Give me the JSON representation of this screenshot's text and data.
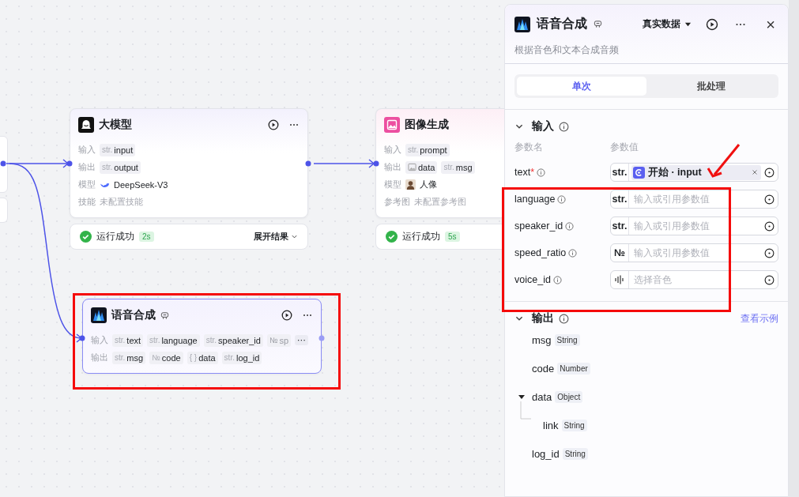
{
  "canvas": {
    "nodes": [
      {
        "title": "大模型",
        "kind": "llm",
        "selected": false,
        "rows": [
          {
            "label": "输入",
            "kind": "params",
            "params": [
              {
                "type": "str.",
                "name": "input"
              }
            ]
          },
          {
            "label": "输出",
            "kind": "params",
            "params": [
              {
                "type": "str.",
                "name": "output"
              }
            ]
          },
          {
            "label": "模型",
            "kind": "model",
            "value": "DeepSeek-V3"
          },
          {
            "label": "技能",
            "kind": "empty",
            "value": "未配置技能"
          }
        ],
        "status": {
          "text": "运行成功",
          "duration": "2s",
          "expand": "展开结果"
        }
      },
      {
        "title": "图像生成",
        "kind": "image",
        "selected": false,
        "rows": [
          {
            "label": "输入",
            "kind": "params",
            "params": [
              {
                "type": "str.",
                "name": "prompt"
              }
            ]
          },
          {
            "label": "输出",
            "kind": "params",
            "params": [
              {
                "kind": "image",
                "name": "data"
              },
              {
                "type": "str.",
                "name": "msg"
              }
            ]
          },
          {
            "label": "模型",
            "kind": "model",
            "value": "人像"
          },
          {
            "label": "参考图",
            "kind": "empty",
            "value": "未配置参考图"
          }
        ],
        "status": {
          "text": "运行成功",
          "duration": "5s"
        }
      },
      {
        "title": "语音合成",
        "kind": "voice",
        "badge": true,
        "selected": true,
        "rows": [
          {
            "label": "输入",
            "kind": "params",
            "more": "⋯",
            "params": [
              {
                "type": "str.",
                "name": "text"
              },
              {
                "type": "str.",
                "name": "language"
              },
              {
                "type": "str.",
                "name": "speaker_id"
              },
              {
                "type": "№",
                "name": "sp",
                "faded": true
              }
            ]
          },
          {
            "label": "输出",
            "kind": "params",
            "params": [
              {
                "type": "str.",
                "name": "msg"
              },
              {
                "type": "№",
                "name": "code"
              },
              {
                "type": "{ }",
                "name": "data"
              },
              {
                "type": "str.",
                "name": "log_id"
              }
            ]
          }
        ]
      }
    ]
  },
  "panel": {
    "title": "语音合成",
    "badge": true,
    "subtitle": "根据音色和文本合成音频",
    "data_source": "真实数据",
    "close": "×",
    "tabs": [
      {
        "label": "单次",
        "selected": true
      },
      {
        "label": "批处理",
        "selected": false
      }
    ],
    "input": {
      "title": "输入",
      "expanded": true,
      "columns": [
        "参数名",
        "参数值"
      ],
      "params": [
        {
          "name": "text",
          "required_mark": "*",
          "kind": "reference",
          "type": "str.",
          "reference": "开始 · input"
        },
        {
          "name": "language",
          "kind": "text",
          "type": "str.",
          "placeholder": "输入或引用参数值"
        },
        {
          "name": "speaker_id",
          "kind": "text",
          "type": "str.",
          "placeholder": "输入或引用参数值"
        },
        {
          "name": "speed_ratio",
          "kind": "text",
          "type": "№",
          "placeholder": "输入或引用参数值"
        },
        {
          "name": "voice_id",
          "kind": "voice",
          "placeholder": "选择音色"
        }
      ]
    },
    "output": {
      "title": "输出",
      "expanded": true,
      "link": "查看示例",
      "fields": [
        {
          "name": "msg",
          "type": "String"
        },
        {
          "name": "code",
          "type": "Number"
        },
        {
          "name": "data",
          "type": "Object",
          "expanded": true,
          "children": [
            {
              "name": "link",
              "type": "String"
            }
          ]
        },
        {
          "name": "log_id",
          "type": "String"
        }
      ]
    }
  }
}
